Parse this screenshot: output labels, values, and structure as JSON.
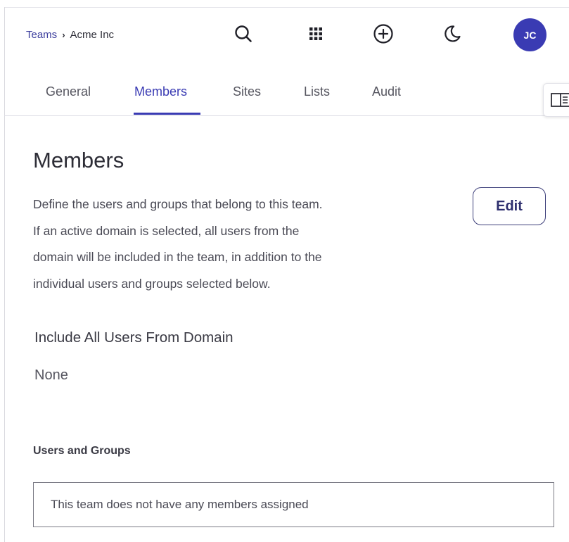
{
  "breadcrumb": {
    "parent": "Teams",
    "separator": "›",
    "current": "Acme Inc"
  },
  "header": {
    "icons": [
      "search-icon",
      "apps-grid-icon",
      "add-circle-icon",
      "dark-mode-icon"
    ],
    "avatar_initials": "JC",
    "avatar_color": "#3a3bb3"
  },
  "tabs": [
    {
      "label": "General",
      "active": false
    },
    {
      "label": "Members",
      "active": true
    },
    {
      "label": "Sites",
      "active": false
    },
    {
      "label": "Lists",
      "active": false
    },
    {
      "label": "Audit",
      "active": false
    }
  ],
  "colors": {
    "accent": "#3a3bb3",
    "edit_border": "#3d3f7a"
  },
  "members": {
    "title": "Members",
    "description_lines": [
      "Define the users and groups that belong to this team.",
      "If an active domain is selected, all users from the",
      "domain will be included in the team, in addition to the",
      "individual users and groups selected below."
    ],
    "edit_label": "Edit",
    "domain_heading": "Include All Users From Domain",
    "domain_value": "None",
    "users_groups_label": "Users and Groups",
    "users_groups_empty": "This team does not have any members assigned"
  }
}
